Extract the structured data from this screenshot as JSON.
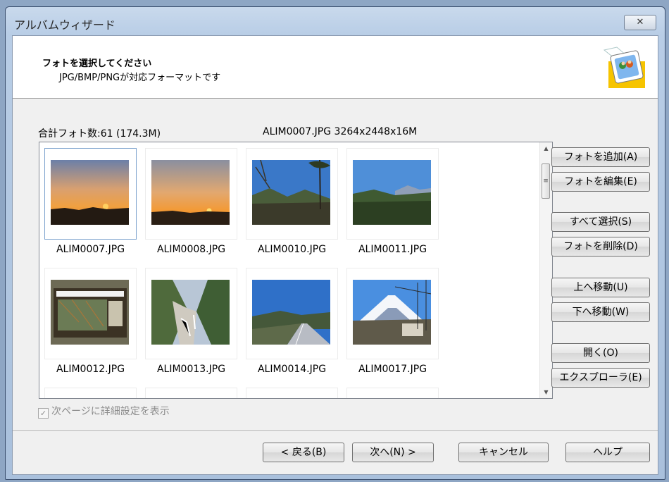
{
  "window": {
    "title": "アルバムウィザード",
    "close_label": "✕"
  },
  "header": {
    "heading": "フォトを選択してください",
    "subtitle": "JPG/BMP/PNGが対応フォーマットです"
  },
  "status": {
    "total": "合計フォト数:61 (174.3M)",
    "selected_info": "ALIM0007.JPG  3264x2448x16M"
  },
  "photos": [
    {
      "name": "ALIM0007.JPG",
      "selected": true
    },
    {
      "name": "ALIM0008.JPG"
    },
    {
      "name": "ALIM0010.JPG"
    },
    {
      "name": "ALIM0011.JPG"
    },
    {
      "name": "ALIM0012.JPG"
    },
    {
      "name": "ALIM0013.JPG"
    },
    {
      "name": "ALIM0014.JPG"
    },
    {
      "name": "ALIM0017.JPG"
    }
  ],
  "side_buttons": {
    "add": "フォトを追加(A)",
    "edit": "フォトを編集(E)",
    "select_all": "すべて選択(S)",
    "delete": "フォトを削除(D)",
    "move_up": "上へ移動(U)",
    "move_down": "下へ移動(W)",
    "open": "開く(O)",
    "explorer": "エクスプローラ(E)"
  },
  "options": {
    "show_details": "次ページに詳細設定を表示",
    "show_details_checked": true
  },
  "footer": {
    "back": "< 戻る(B)",
    "next": "次へ(N) >",
    "cancel": "キャンセル",
    "help": "ヘルプ"
  }
}
